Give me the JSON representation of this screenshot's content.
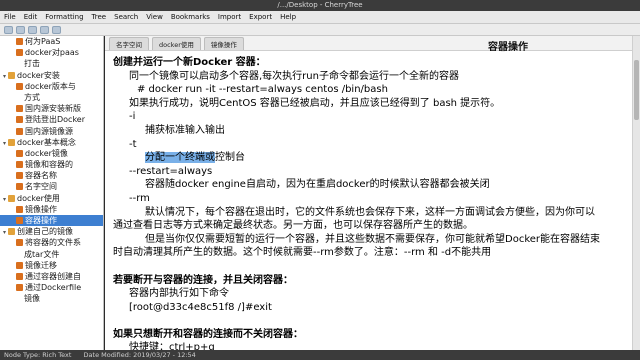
{
  "window": {
    "title": "/.../Desktop - CherryTree"
  },
  "menu": [
    "File",
    "Edit",
    "Formatting",
    "Tree",
    "Search",
    "View",
    "Bookmarks",
    "Import",
    "Export",
    "Help"
  ],
  "sidebar": {
    "items": [
      {
        "label": "何为PaaS",
        "kind": "leaf",
        "indent": 2
      },
      {
        "label": "docker对paas",
        "kind": "leaf",
        "indent": 2
      },
      {
        "label": "打击",
        "kind": "cont",
        "indent": 3
      },
      {
        "label": "docker安装",
        "kind": "folder",
        "indent": 1,
        "twisty": "▾"
      },
      {
        "label": "docker版本与",
        "kind": "leaf",
        "indent": 2
      },
      {
        "label": "方式",
        "kind": "cont",
        "indent": 3
      },
      {
        "label": "国内源安装新版",
        "kind": "leaf",
        "indent": 2
      },
      {
        "label": "登陆登出Docker",
        "kind": "leaf",
        "indent": 2
      },
      {
        "label": "国内源镜像源",
        "kind": "leaf",
        "indent": 2
      },
      {
        "label": "docker基本概念",
        "kind": "folder",
        "indent": 1,
        "twisty": "▾"
      },
      {
        "label": "docker镜像",
        "kind": "leaf",
        "indent": 2
      },
      {
        "label": "镜像和容器的",
        "kind": "leaf",
        "indent": 2
      },
      {
        "label": "容器名称",
        "kind": "leaf",
        "indent": 2
      },
      {
        "label": "名字空间",
        "kind": "leaf",
        "indent": 2
      },
      {
        "label": "docker使用",
        "kind": "folder",
        "indent": 1,
        "twisty": "▾"
      },
      {
        "label": "镜像操作",
        "kind": "leaf",
        "indent": 2
      },
      {
        "label": "容器操作",
        "kind": "leaf",
        "indent": 2,
        "selected": true
      },
      {
        "label": "创建自己的镜像",
        "kind": "folder",
        "indent": 1,
        "twisty": "▾"
      },
      {
        "label": "将容器的文件系",
        "kind": "leaf",
        "indent": 2
      },
      {
        "label": "成tar文件",
        "kind": "cont",
        "indent": 3
      },
      {
        "label": "镜像迁移",
        "kind": "leaf",
        "indent": 2
      },
      {
        "label": "通过容器创建自",
        "kind": "leaf",
        "indent": 2
      },
      {
        "label": "通过Dockerfile",
        "kind": "leaf",
        "indent": 2
      },
      {
        "label": "镜像",
        "kind": "cont",
        "indent": 3
      }
    ]
  },
  "tabs": [
    "名字空间",
    "docker使用",
    "镜像操作"
  ],
  "node_title": "容器操作",
  "content": {
    "lines": [
      {
        "text": "创建并运行一个新Docker 容器：",
        "cls": "bold"
      },
      {
        "text": "同一个镜像可以启动多个容器,每次执行run子命令都会运行一个全新的容器",
        "cls": "i1"
      },
      {
        "text": "# docker run -it --restart=always centos /bin/bash",
        "cls": "i2"
      },
      {
        "text": "如果执行成功，说明CentOS 容器已经被启动，并且应该已经得到了 bash 提示符。",
        "cls": "i1"
      },
      {
        "text": "-i",
        "cls": "i1"
      },
      {
        "text": "捕获标准输入输出",
        "cls": "i3"
      },
      {
        "text": "-t",
        "cls": "i1"
      },
      {
        "text_hl": "分配一个终端或",
        "text": "控制台",
        "cls": "i3"
      },
      {
        "text": "--restart=always",
        "cls": "i1"
      },
      {
        "text": "容器随docker engine自启动，因为在重启docker的时候默认容器都会被关闭",
        "cls": "i3"
      },
      {
        "text": "--rm",
        "cls": "i1"
      },
      {
        "text": "默认情况下，每个容器在退出时，它的文件系统也会保存下来，这样一方面调试会方便些，因为你可以",
        "cls": "i3"
      },
      {
        "text": "通过查看日志等方式来确定最终状态。另一方面，也可以保存容器所产生的数据。",
        "cls": ""
      },
      {
        "text": "但是当你仅仅需要短暂的运行一个容器，并且这些数据不需要保存，你可能就希望Docker能在容器结束",
        "cls": "i3"
      },
      {
        "text": "时自动清理其所产生的数据。这个时候就需要--rm参数了。注意：--rm 和 -d不能共用",
        "cls": ""
      },
      {
        "text": "",
        "cls": ""
      },
      {
        "text": "若要断开与容器的连接，并且关闭容器：",
        "cls": "bold"
      },
      {
        "text": "容器内部执行如下命令",
        "cls": "i1"
      },
      {
        "text": "[root@d33c4e8c51f8 /]#exit",
        "cls": "i1"
      },
      {
        "text": "",
        "cls": ""
      },
      {
        "text": "如果只想断开和容器的连接而不关闭容器：",
        "cls": "bold"
      },
      {
        "text": "快捷键：ctrl+p+q",
        "cls": "i1"
      }
    ]
  },
  "statusbar": {
    "node_type": "Node Type: Rich Text",
    "modified": "Date Modified: 2019/03/27 - 12:54"
  }
}
